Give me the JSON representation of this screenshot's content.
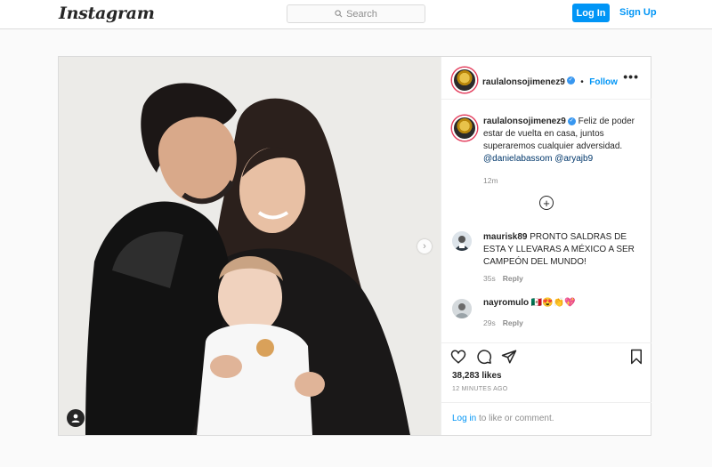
{
  "topbar": {
    "logo": "Instagram",
    "search_placeholder": "Search",
    "login_label": "Log In",
    "signup_label": "Sign Up"
  },
  "post": {
    "username": "raulalonsojimenez9",
    "follow_label": "Follow",
    "more_label": "•••",
    "caption": {
      "text": "Feliz de poder estar de vuelta en casa, juntos superaremos cualquier adversidad.",
      "mention1": "@danielabassom",
      "mention2": "@aryajb9",
      "time": "12m"
    },
    "comments": [
      {
        "username": "maurisk89",
        "text": "PRONTO SALDRAS DE ESTA Y LLEVARAS A MÉXICO A SER CAMPEÓN DEL MUNDO!",
        "time": "35s",
        "reply": "Reply"
      },
      {
        "username": "nayromulo",
        "text": "🇲🇽😍👏💖",
        "time": "29s",
        "reply": "Reply"
      }
    ],
    "likes": "38,283 likes",
    "time_ago": "12 MINUTES AGO",
    "login_prompt_link": "Log in",
    "login_prompt_rest": " to like or comment."
  },
  "colors": {
    "accent": "#0095f6",
    "verified": "#3897f0",
    "border": "#dbdbdb"
  }
}
